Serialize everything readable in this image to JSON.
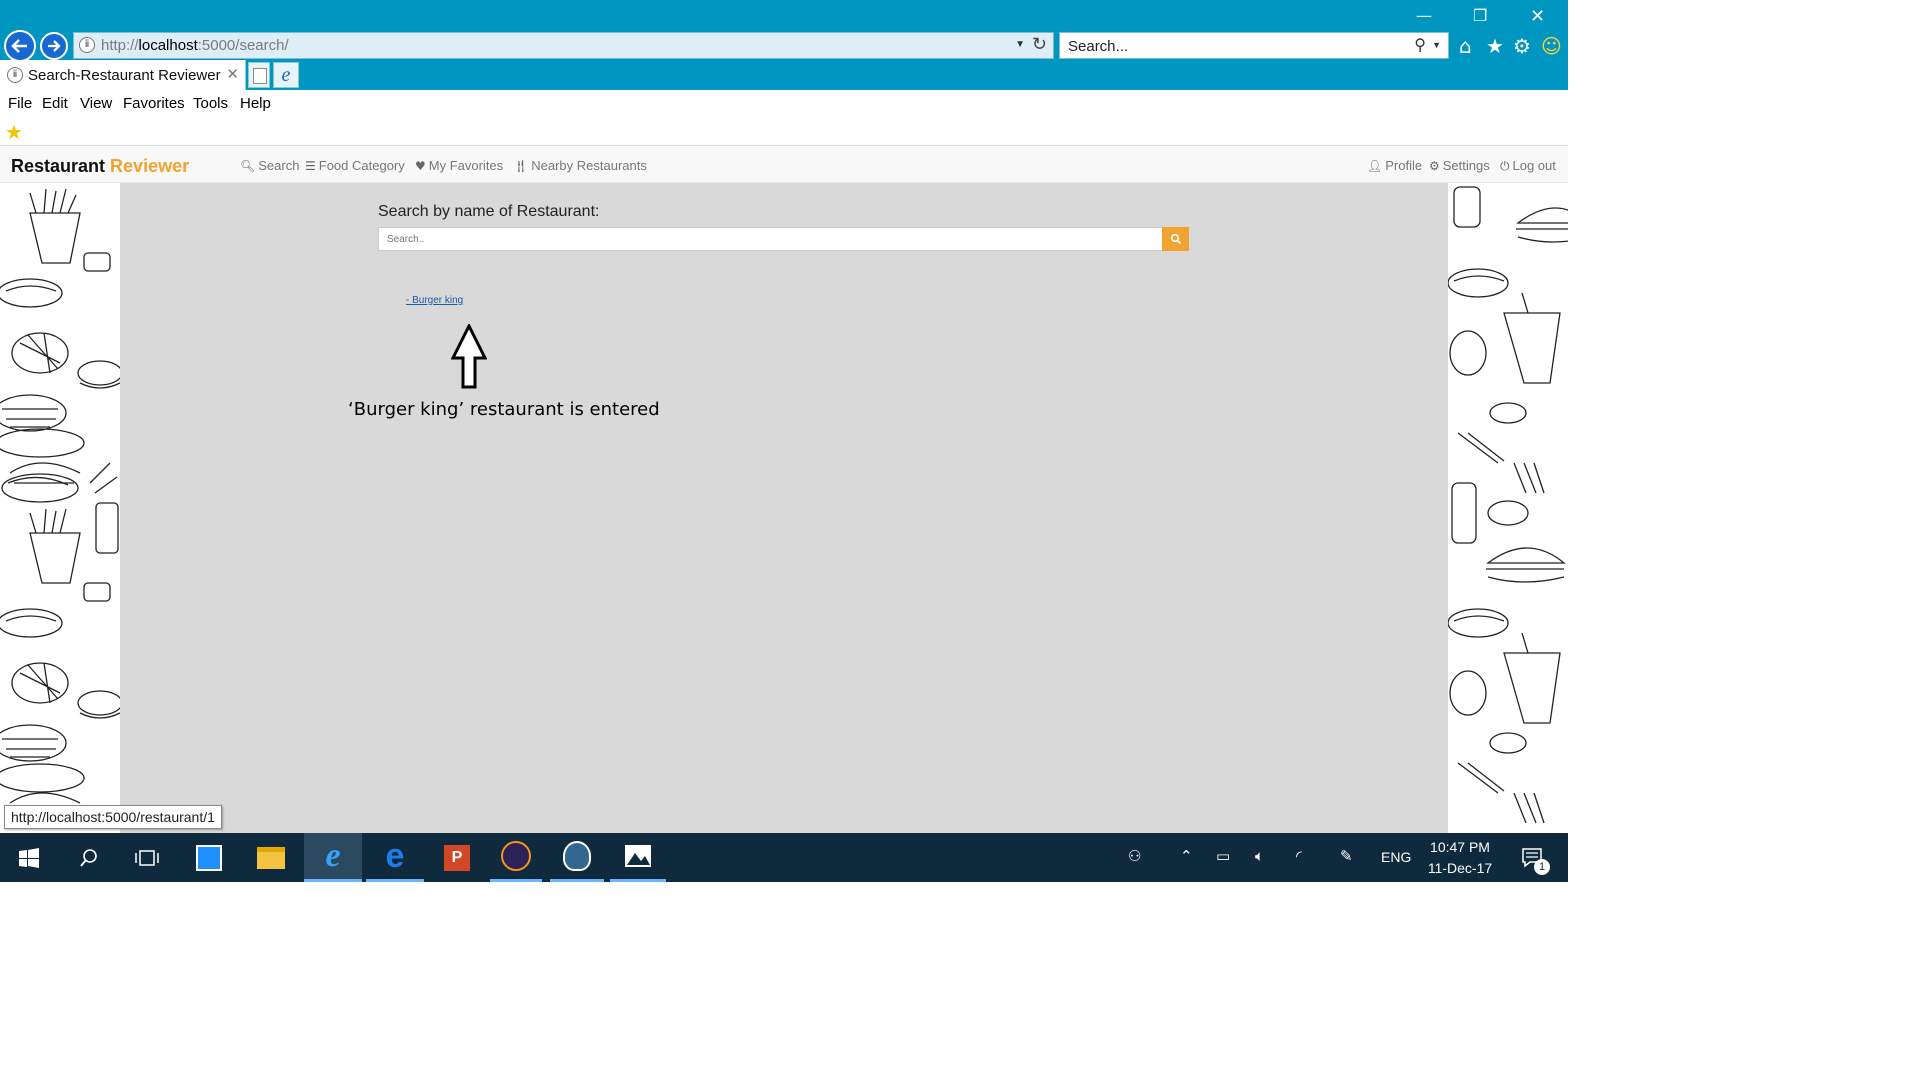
{
  "browser": {
    "address_prefix": "http://",
    "address_host": "localhost",
    "address_rest": ":5000/search/",
    "search_placeholder": "Search...",
    "tab_title": "Search-Restaurant Reviewer",
    "status_url": "http://localhost:5000/restaurant/1",
    "accent_color": "#0096c2"
  },
  "menu": [
    "File",
    "Edit",
    "View",
    "Favorites",
    "Tools",
    "Help"
  ],
  "site": {
    "brand_main": "Restaurant",
    "brand_accent": "Reviewer",
    "accent_color": "#f0a330",
    "nav": [
      {
        "label": "Search",
        "icon": "search-icon"
      },
      {
        "label": "Food Category",
        "icon": "list-icon"
      },
      {
        "label": "My Favorites",
        "icon": "heart-icon"
      },
      {
        "label": "Nearby Restaurants",
        "icon": "cutlery-icon"
      }
    ],
    "nav_right": [
      {
        "label": "Profile",
        "icon": "user-icon"
      },
      {
        "label": "Settings",
        "icon": "cog-icon"
      },
      {
        "label": "Log out",
        "icon": "power-icon"
      }
    ]
  },
  "page": {
    "search_label": "Search by name of Restaurant:",
    "search_placeholder": "Search..",
    "result": "- Burger king",
    "annotation": "‘Burger king’ restaurant is entered"
  },
  "taskbar": {
    "time": "10:47 PM",
    "date": "11-Dec-17",
    "lang": "ENG",
    "notification_count": "1"
  }
}
